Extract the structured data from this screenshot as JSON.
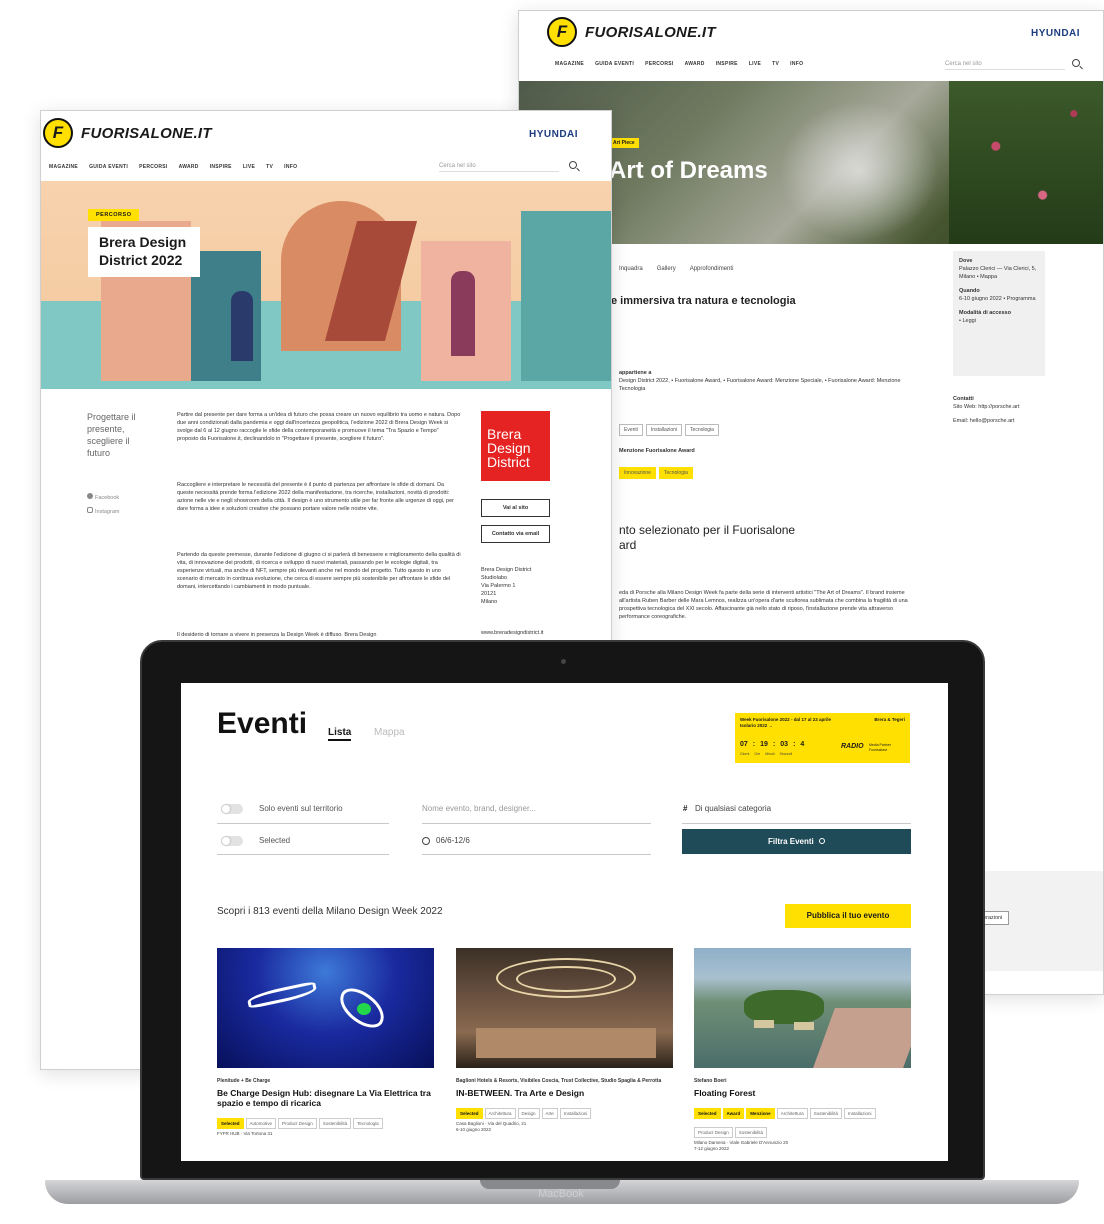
{
  "brand": {
    "logo_letter": "F",
    "logo_text": "FUORISALONE.IT",
    "sponsor": "HYUNDAI",
    "colors": {
      "accent_yellow": "#ffe000",
      "dark_teal": "#1f4a58",
      "brera_red": "#e52323"
    }
  },
  "nav": {
    "items": [
      "MAGAZINE",
      "GUIDA EVENTI",
      "PERCORSI",
      "AWARD",
      "INSPIRE",
      "LIVE",
      "TV",
      "INFO"
    ],
    "search_placeholder": "Cerca nel sito"
  },
  "back_page": {
    "badge": "Art Piece",
    "hero_title": "Art of Dreams",
    "tabs": [
      "Inquadra",
      "Gallery",
      "Approfondimenti"
    ],
    "subtitle": "e immersiva tra natura e tecnologia",
    "belongs_label": "appartiene a",
    "belongs_text": "Design District 2022, • Fuorisalone Award, • Fuorisalone Award: Menzione Speciale, • Fuorisalone Award: Menzione Tecnologia",
    "tags": [
      "Eventi",
      "Installazioni",
      "Tecnologia"
    ],
    "award_label": "Menzione Fuorisalone Award",
    "award_chips": [
      "Innovazione",
      "Tecnologia"
    ],
    "award_heading_1": "nto selezionato per il Fuorisalone",
    "award_heading_2": "ard",
    "body": "eda di Porsche alla Milano Design Week fa parte della serie di interventi artistici \"The Art of Dreams\". Il brand insieme all'artista Ruben Barber delle Mara Lemnos, realizza un'opera d'arte scultorea sublimata che combina la fragilità di una prospettiva tecnologica del XXI secolo. Affascinante già nello stato di riposo, l'installazione prende vita attraverso performance coreografiche.",
    "info": {
      "where_label": "Dove",
      "where_value": "Palazzo Clerici — Via Clerici, 5, Milano • Mappa",
      "when_label": "Quando",
      "when_value": "6-10 giugno 2022 • Programma",
      "access_label": "Modalità di accesso",
      "access_value": "• Leggi",
      "contacts_label": "Contatti",
      "contacts_web": "Sito Web: http://porsche.art",
      "contacts_email": "Email: hello@porsche.art",
      "footer_button": "Rane e interazioni"
    }
  },
  "front_page": {
    "badge": "PERCORSO",
    "hero_title_1": "Brera Design",
    "hero_title_2": "District 2022",
    "side_title": "Progettare il presente, scegliere il futuro",
    "social": [
      "Facebook",
      "Instagram"
    ],
    "para1": "Partire dal presente per dare forma a un'idea di futuro che possa creare un nuovo equilibrio tra uomo e natura. Dopo due anni condizionati dalla pandemia e oggi dall'incertezza geopolitica, l'edizione 2022 di Brera Design Week si svolge dal 6 al 12 giugno raccoglie le sfide della contemporaneità e promuove il tema \"Tra Spazio e Tempo\" proposto da Fuorisalone.it, declinandolo in \"Progettare il presente, scegliere il futuro\".",
    "para2": "Raccogliere e interpretare le necessità del presente è il punto di partenza per affrontare le sfide di domani. Da queste necessità prende forma l'edizione 2022 della manifestazione, tra ricerche, installazioni, novità di prodotti: azione nelle vie e negli showroom della città. Il design è uno strumento utile per far fronte alle urgenze di oggi, per dare forma a idee e soluzioni creative che possano portare valore nelle nostre vite.",
    "para3": "Partendo da queste premesse, durante l'edizione di giugno ci si parlerà di benessere e miglioramento della qualità di vita, di innovazione dei prodotti, di ricerca e sviluppo di nuovi materiali, passando per le ecologie digitali, tra esperienze virtuali, ma anche di NFT, sempre più rilevanti anche nel mondo del progetto. Tutto questo in uno scenario di mercato in continua evoluzione, che cerca di essere sempre più sostenibile per affrontare le sfide del domani, intercettando i cambiamenti in modo puntuale.",
    "para4": "Il desiderio di tornare a vivere in presenza la Design Week è diffuso. Brera Design",
    "brera_logo": [
      "Brera",
      "Design",
      "District"
    ],
    "btn_site": "Vai al sito",
    "btn_email": "Contatto via email",
    "address": [
      "Brera Design District",
      "Studiolabo",
      "Via Palermo 1",
      "20121",
      "Milano"
    ],
    "url": "www.breradesigndistrict.it"
  },
  "laptop": {
    "brand": "MacBook",
    "title": "Eventi",
    "view_tabs": {
      "list": "Lista",
      "map": "Mappa"
    },
    "banner": {
      "line1": "Week Fuorisalone 2022 - dal 17 al 23 aprile",
      "line2": "Isolario 2022 →",
      "right": "Brera & Tegeri",
      "days": "07",
      "hours": "19",
      "mins": "03",
      "secs": "4",
      "units": [
        "Giorni",
        "Ore",
        "Minuti",
        "Secondi"
      ],
      "partner": "RADIO",
      "partner_sub": "Media Partner Fuorisalone"
    },
    "filters": {
      "toggle1": "Solo eventi sul territorio",
      "toggle2": "Selected",
      "name_placeholder": "Nome evento, brand, designer...",
      "date_value": "06/6-12/6",
      "category_value": "Di qualsiasi categoria",
      "submit": "Filtra Eventi"
    },
    "count_text": "Scopri i 813 eventi della Milano Design Week 2022",
    "publish": "Pubblica il tuo evento",
    "events": [
      {
        "category": "Plenitude + Be Charge",
        "title": "Be Charge Design Hub: disegnare La Via Elettrica tra spazio e tempo di ricarica",
        "chips": [
          "Selected",
          "Automotive",
          "Product Design",
          "Sostenibilità",
          "Tecnologia"
        ],
        "place": "FYFR HUB · Via Tortona 31"
      },
      {
        "category": "Baglioni Hotels & Resorts, Visibiles Coscia, Trust Collective, Studio Spaglia & Perrotta",
        "title": "IN-BETWEEN. Tra Arte e Design",
        "chips": [
          "Selected",
          "Architettura",
          "Design",
          "Arte",
          "Installazioni"
        ],
        "place": "Casa Baglioni · Via del Quadrio, 21",
        "date": "6-10 giugno 2022"
      },
      {
        "category": "Stefano Boeri",
        "title": "Floating Forest",
        "chips": [
          "Selected",
          "Award",
          "Menzione",
          "Architettura",
          "Sostenibilità",
          "Installazioni",
          "Product Design",
          "Sostenibilità"
        ],
        "place": "Milano Darsena · Viale Gabriele D'Annunzio 20",
        "date": "7-12 giugno 2022"
      }
    ]
  }
}
